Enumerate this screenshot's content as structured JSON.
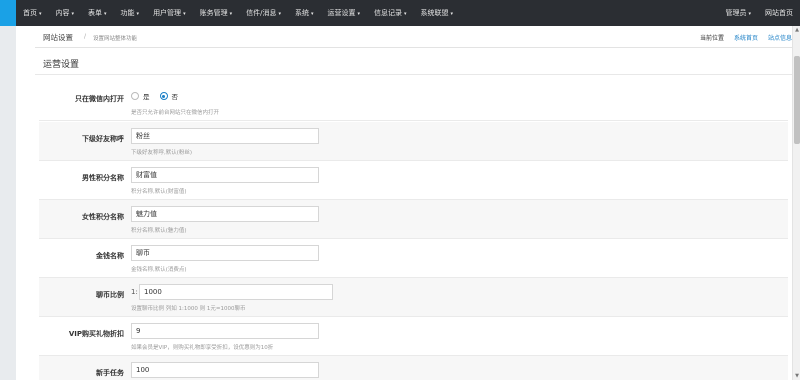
{
  "nav": {
    "items": [
      {
        "label": "首页"
      },
      {
        "label": "内容"
      },
      {
        "label": "表单"
      },
      {
        "label": "功能"
      },
      {
        "label": "用户管理"
      },
      {
        "label": "账务管理"
      },
      {
        "label": "信件/消息"
      },
      {
        "label": "系统"
      },
      {
        "label": "运营设置"
      },
      {
        "label": "信息记录"
      },
      {
        "label": "系统联盟"
      }
    ],
    "right": [
      {
        "label": "管理员",
        "caret": true
      },
      {
        "label": "网站首页",
        "caret": false
      }
    ],
    "caret": "▾"
  },
  "breadcrumb": {
    "title": "网站设置",
    "separator": "/",
    "desc": "设置网站整体功能",
    "current": "当前位置",
    "links": [
      "系统首页",
      "站点信息"
    ]
  },
  "panel": {
    "title": "运营设置"
  },
  "form": {
    "wechat_only": {
      "label": "只在微信内打开",
      "options": [
        {
          "label": "是",
          "checked": false
        },
        {
          "label": "否",
          "checked": true
        }
      ],
      "help": "是否只允许前台网站只在微信内打开"
    },
    "friend_title": {
      "label": "下级好友称呼",
      "value": "粉丝",
      "help": "下级好友称呼,默认(粉丝)"
    },
    "male_points": {
      "label": "男性积分名称",
      "value": "财富值",
      "help": "积分名称,默认(财富值)"
    },
    "female_points": {
      "label": "女性积分名称",
      "value": "魅力值",
      "help": "积分名称,默认(魅力值)"
    },
    "currency_name": {
      "label": "金钱名称",
      "value": "聊币",
      "help": "金钱名称,默认(消费点)"
    },
    "currency_ratio": {
      "label": "聊币比例",
      "prefix": "1:",
      "value": "1000",
      "help": "设置聊币比例 列如 1:1000 则 1元=1000聊币"
    },
    "vip_discount": {
      "label": "VIP购买礼物折扣",
      "value": "9",
      "help": "如果会员是VIP，则购买礼物即享受折扣，设优惠则为10折"
    },
    "newbie_task": {
      "label": "新手任务",
      "value": "100"
    }
  },
  "colors": {
    "topbar": "#2b2e33",
    "accent": "#1aa1e6",
    "link": "#1a7fc6"
  }
}
